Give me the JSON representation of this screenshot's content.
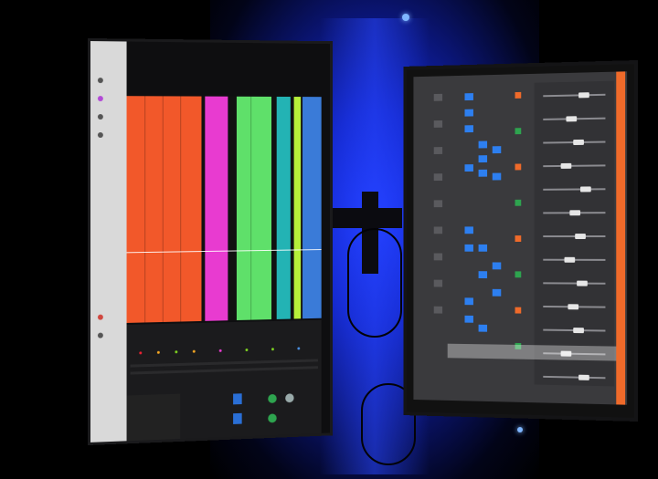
{
  "scene": {
    "description_label": "",
    "colors": {
      "backlight": "#1f3bff",
      "track_orange": "#f2582a",
      "track_magenta": "#e83bd0",
      "track_green": "#5fe06a",
      "track_teal": "#23b3b4",
      "track_lime": "#b6f03a",
      "track_blue": "#3a7bd8",
      "mixer_button_blue": "#2d7ff0",
      "mixer_strip_orange": "#ef6a2a"
    },
    "left_monitor": {
      "icon": "daw-arrange-window-icon",
      "track_colors": [
        "track_orange",
        "track_magenta",
        "track_green",
        "track_teal",
        "track_lime",
        "track_blue"
      ]
    },
    "right_monitor": {
      "icon": "daw-mixer-window-icon"
    }
  }
}
